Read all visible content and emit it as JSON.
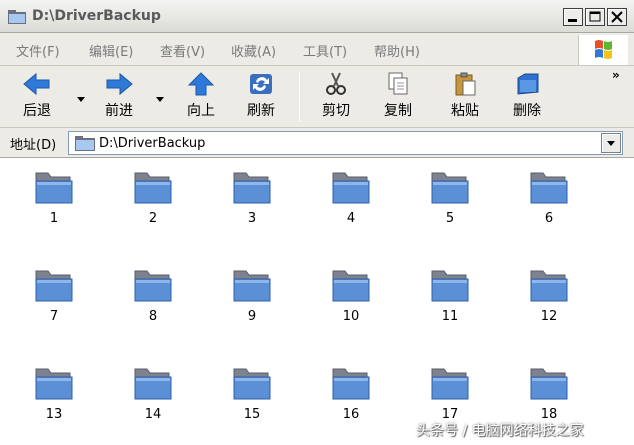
{
  "window": {
    "title": "D:\\DriverBackup"
  },
  "menu": [
    "文件(F)",
    "编辑(E)",
    "查看(V)",
    "收藏(A)",
    "工具(T)",
    "帮助(H)"
  ],
  "toolbar": {
    "back": "后退",
    "forward": "前进",
    "up": "向上",
    "refresh": "刷新",
    "cut": "剪切",
    "copy": "复制",
    "paste": "粘贴",
    "delete": "删除",
    "more": "»"
  },
  "address": {
    "label": "地址(D)",
    "path": "D:\\DriverBackup"
  },
  "folders": [
    "1",
    "2",
    "3",
    "4",
    "5",
    "6",
    "7",
    "8",
    "9",
    "10",
    "11",
    "12",
    "13",
    "14",
    "15",
    "16",
    "17",
    "18"
  ],
  "watermark": "头条号 / 电脑网络科技之家",
  "colors": {
    "folder_front": "#5b8fd6",
    "folder_back": "#8a8d99",
    "accent": "#2f6fce"
  }
}
